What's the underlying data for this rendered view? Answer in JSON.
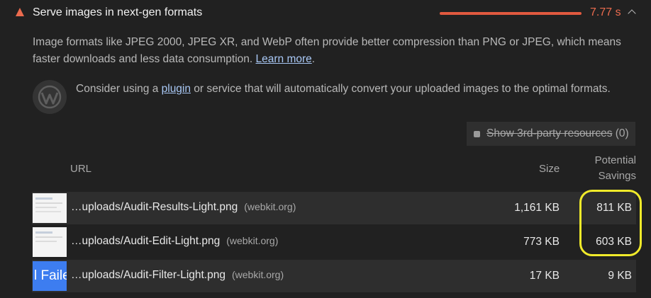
{
  "audit": {
    "title": "Serve images in next-gen formats",
    "metric": "7.77 s",
    "description_text": "Image formats like JPEG 2000, JPEG XR, and WebP often provide better compression than PNG or JPEG, which means faster downloads and less data consumption. ",
    "learn_more": "Learn more",
    "period": "."
  },
  "stack_pack": {
    "icon": "wordpress-icon",
    "text_before": "Consider using a ",
    "link": "plugin",
    "text_after": " or service that will automatically convert your uploaded images to the optimal formats."
  },
  "third_party": {
    "label": "Show 3rd-party resources",
    "count": " (0)"
  },
  "table": {
    "headers": {
      "url": "URL",
      "size": "Size",
      "savings_line1": "Potential",
      "savings_line2": "Savings"
    },
    "rows": [
      {
        "path": "…uploads/Audit-Results-Light.png",
        "host": "(webkit.org)",
        "size": "1,161 KB",
        "savings": "811 KB"
      },
      {
        "path": "…uploads/Audit-Edit-Light.png",
        "host": "(webkit.org)",
        "size": "773 KB",
        "savings": "603 KB"
      },
      {
        "path": "…uploads/Audit-Filter-Light.png",
        "host": "(webkit.org)",
        "size": "17 KB",
        "savings": "9 KB",
        "thumb_text": "l Faile"
      }
    ]
  },
  "colors": {
    "fail": "#eb6b4e",
    "link": "#a9c8f5",
    "highlight": "#f0ea2a"
  }
}
